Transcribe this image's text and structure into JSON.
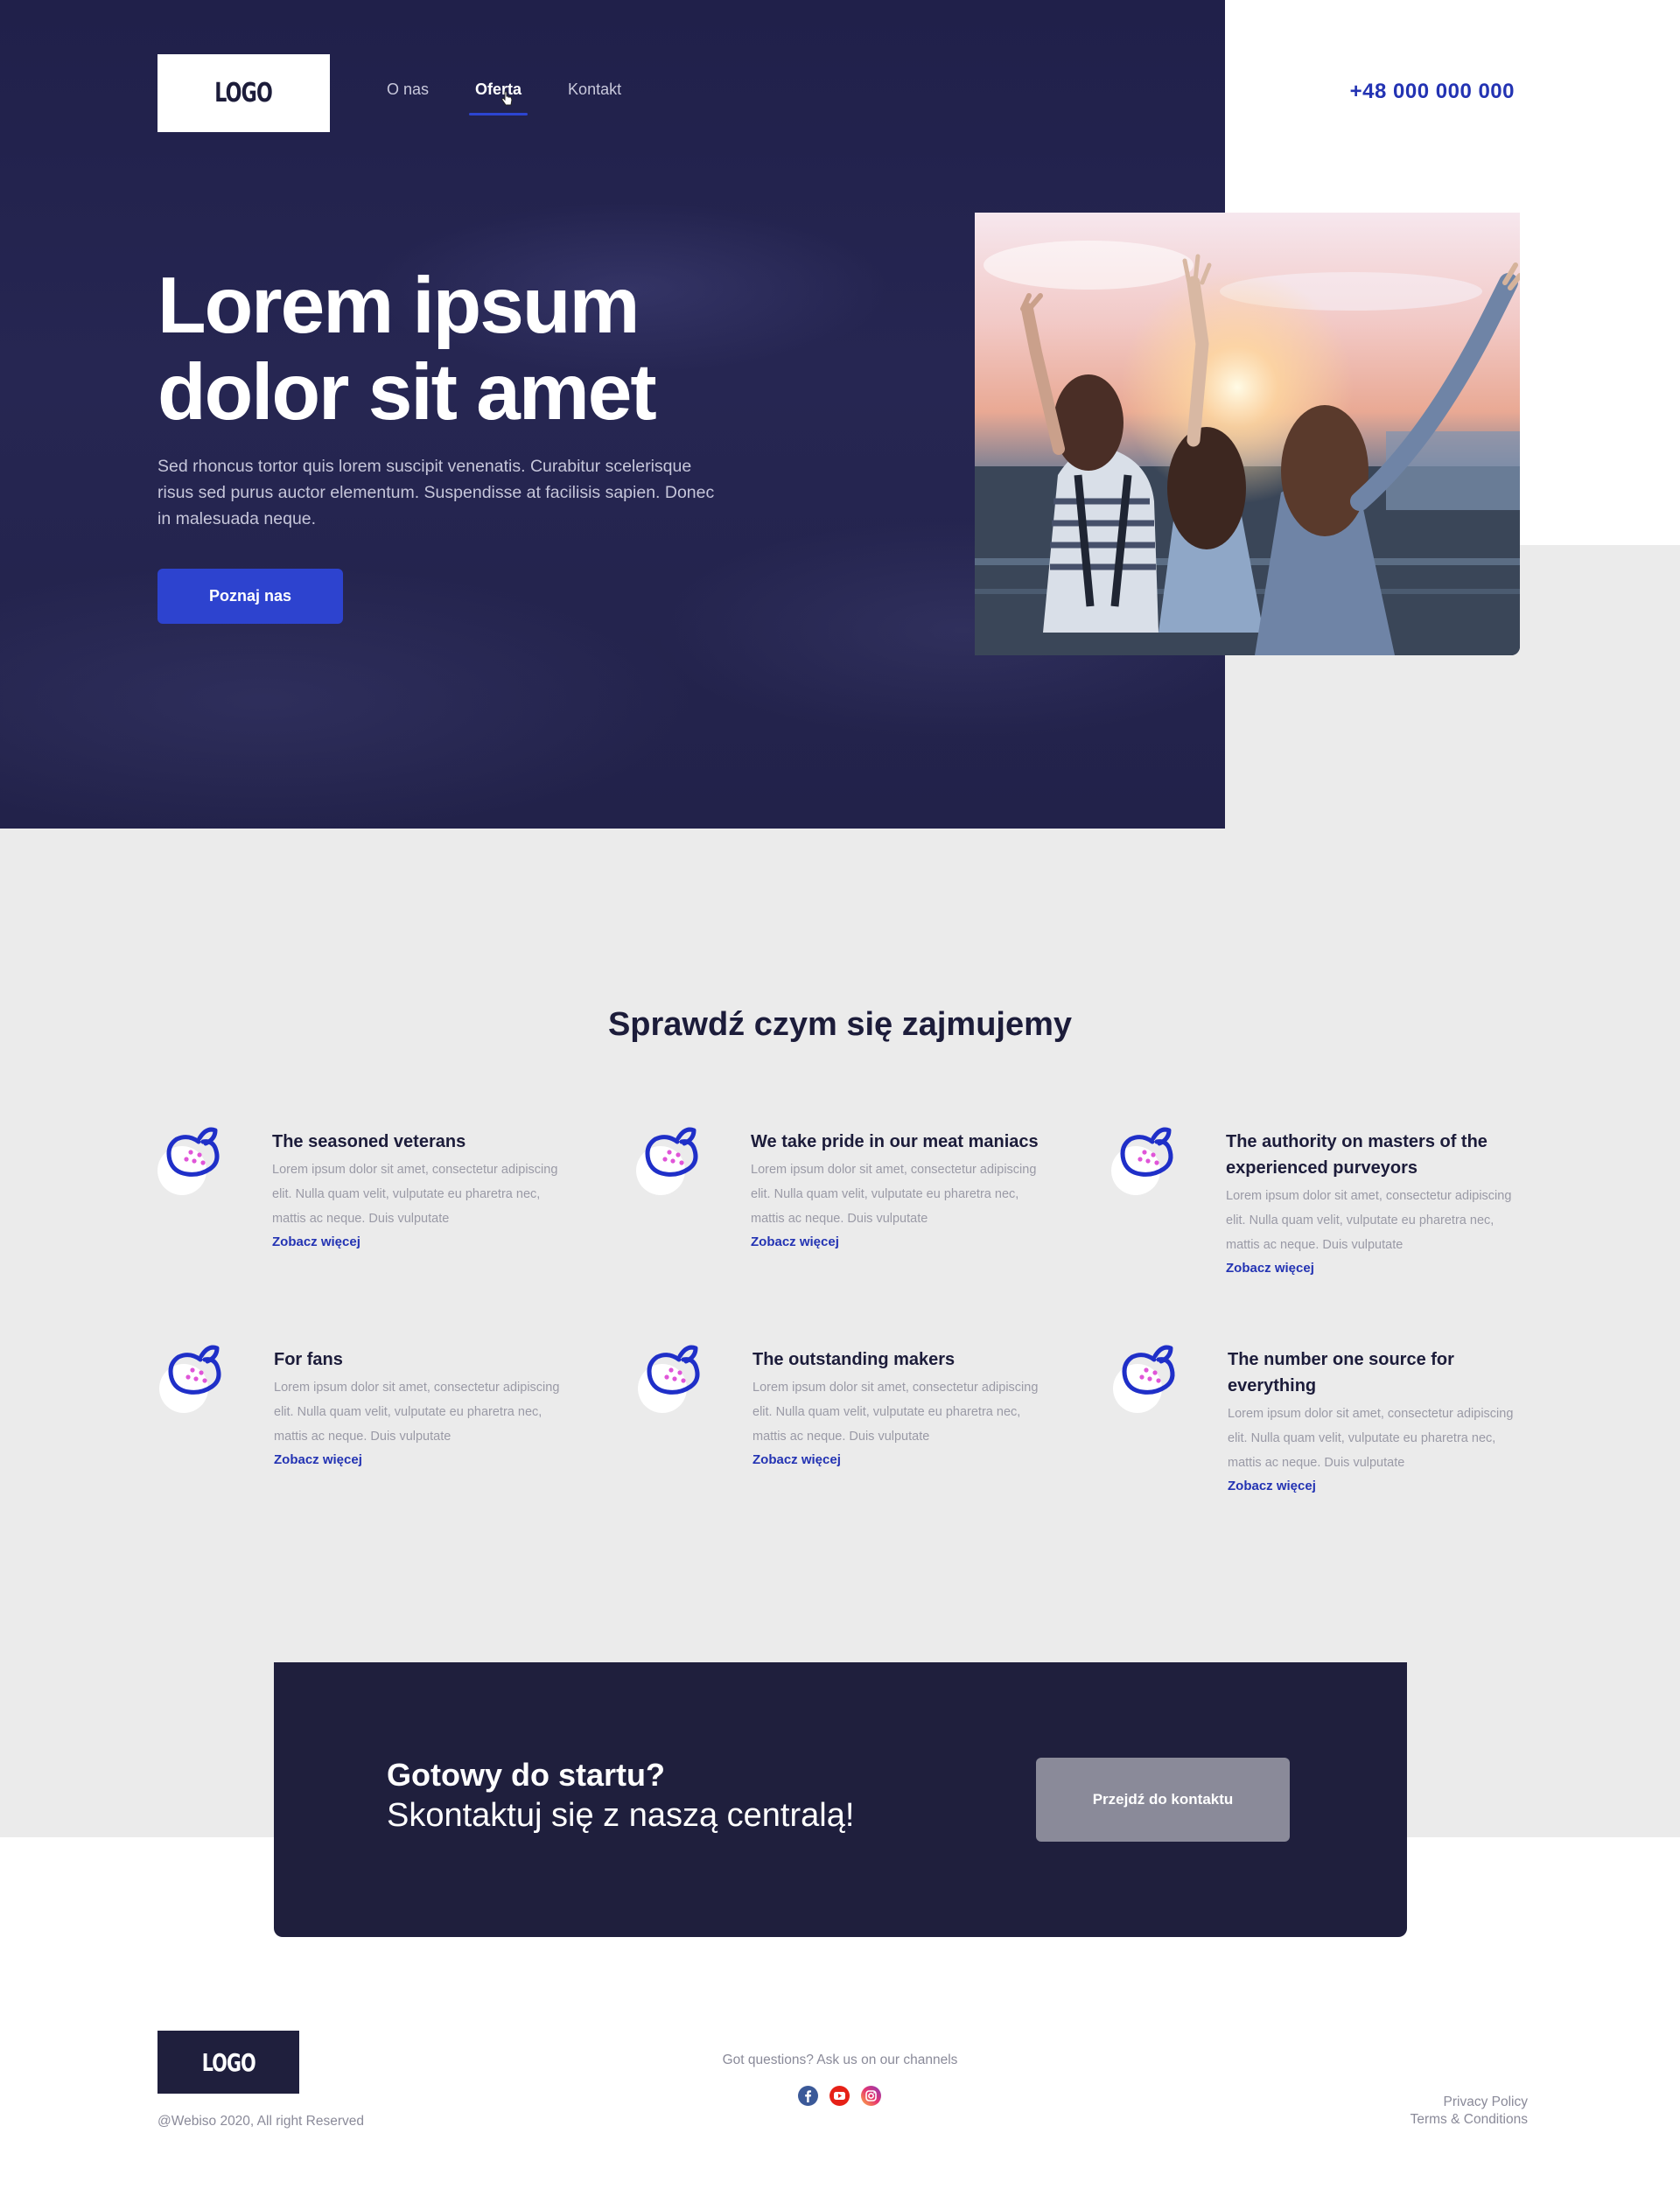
{
  "header": {
    "logo": "LOGO",
    "nav": [
      {
        "label": "O nas"
      },
      {
        "label": "Oferta",
        "active": true
      },
      {
        "label": "Kontakt"
      }
    ],
    "phone": "+48 000 000 000"
  },
  "hero": {
    "title": "Lorem ipsum dolor sit amet",
    "description": "Sed rhoncus tortor quis lorem suscipit venenatis. Curabitur scelerisque risus sed purus auctor elementum. Suspendisse at facilisis sapien. Donec in malesuada neque.",
    "button": "Poznaj nas"
  },
  "services": {
    "title": "Sprawdź czym się zajmujemy",
    "cards": [
      {
        "title": "The seasoned veterans",
        "text": "Lorem ipsum dolor sit amet, consectetur adipiscing elit. Nulla quam velit, vulputate eu pharetra nec, mattis ac neque. Duis vulputate",
        "link": "Zobacz więcej"
      },
      {
        "title": "We take pride in our meat maniacs",
        "text": "Lorem ipsum dolor sit amet, consectetur adipiscing elit. Nulla quam velit, vulputate eu pharetra nec, mattis ac neque. Duis vulputate",
        "link": "Zobacz więcej"
      },
      {
        "title": "The authority on masters of the experienced purveyors",
        "text": "Lorem ipsum dolor sit amet, consectetur adipiscing elit. Nulla quam velit, vulputate eu pharetra nec, mattis ac neque. Duis vulputate",
        "link": "Zobacz więcej"
      },
      {
        "title": "For fans",
        "text": "Lorem ipsum dolor sit amet, consectetur adipiscing elit. Nulla quam velit, vulputate eu pharetra nec, mattis ac neque. Duis vulputate",
        "link": "Zobacz więcej"
      },
      {
        "title": "The outstanding makers",
        "text": "Lorem ipsum dolor sit amet, consectetur adipiscing elit. Nulla quam velit, vulputate eu pharetra nec, mattis ac neque. Duis vulputate",
        "link": "Zobacz więcej"
      },
      {
        "title": "The number one source for everything",
        "text": "Lorem ipsum dolor sit amet, consectetur adipiscing elit. Nulla quam velit, vulputate eu pharetra nec, mattis ac neque. Duis vulputate",
        "link": "Zobacz więcej"
      }
    ]
  },
  "cta": {
    "title": "Gotowy do startu?",
    "subtitle": "Skontaktuj się z naszą centralą!",
    "button": "Przejdź do kontaktu"
  },
  "footer": {
    "logo": "LOGO",
    "copyright": "@Webiso 2020, All right Reserved",
    "questions": "Got questions? Ask us on our channels",
    "socials": [
      {
        "icon": "facebook-icon",
        "color": "#3b5998"
      },
      {
        "icon": "youtube-icon",
        "color": "#e62117"
      },
      {
        "icon": "instagram-icon",
        "color": "#d6249f"
      }
    ],
    "links": [
      {
        "label": "Privacy Policy"
      },
      {
        "label": "Terms & Conditions"
      }
    ]
  },
  "colors": {
    "accent": "#2d43cf",
    "navy": "#1f1f3d",
    "grey_bg": "#ebebeb"
  }
}
